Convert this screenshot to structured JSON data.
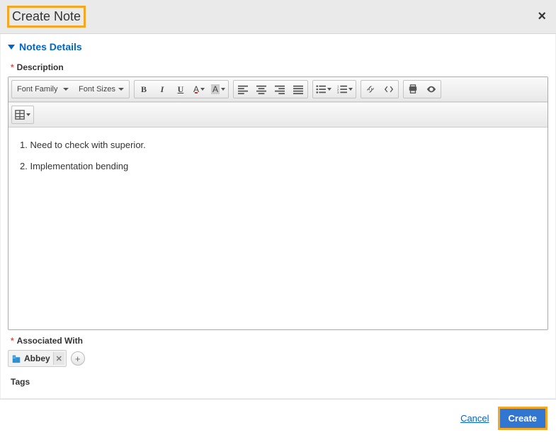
{
  "dialog": {
    "title": "Create Note",
    "close": "×"
  },
  "section": {
    "title": "Notes Details"
  },
  "fields": {
    "description_label": "Description",
    "associated_label": "Associated With",
    "tags_label": "Tags"
  },
  "toolbar": {
    "font_family": "Font Family",
    "font_size": "Font Sizes",
    "bold": "B",
    "italic": "I",
    "underline": "U",
    "textcolor": "A",
    "bgcolor": "A"
  },
  "editor": {
    "items": [
      "Need to check with superior.",
      "Implementation bending"
    ]
  },
  "associated": {
    "chip_label": "Abbey"
  },
  "footer": {
    "cancel": "Cancel",
    "create": "Create"
  }
}
